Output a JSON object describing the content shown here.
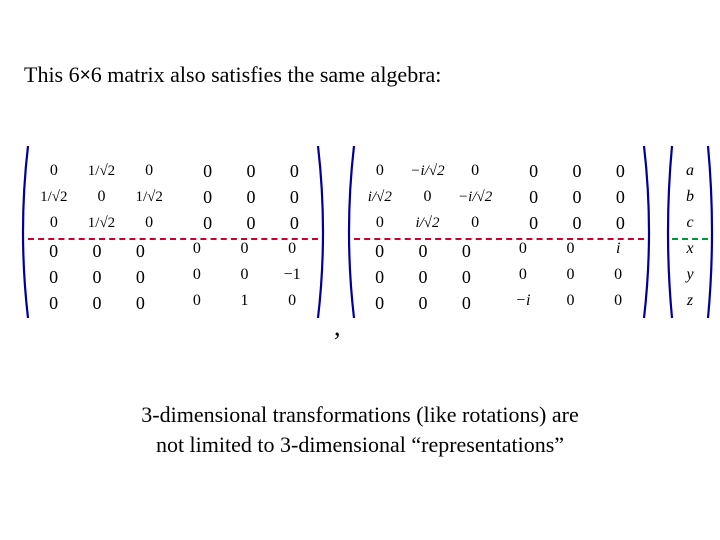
{
  "title": {
    "pre": "This 6",
    "post": "6 matrix also satisfies the same algebra:",
    "times": "×"
  },
  "zeros": [
    "0",
    "0",
    "0",
    "0",
    "0",
    "0",
    "0",
    "0",
    "0"
  ],
  "mat1": {
    "r0": [
      "0",
      "1/√2",
      "0"
    ],
    "r1": [
      "1/√2",
      "0",
      "1/√2"
    ],
    "r2": [
      "0",
      "1/√2",
      "0"
    ],
    "r3": [
      "0",
      "0",
      "0"
    ],
    "r4": [
      "0",
      "0",
      "−1"
    ],
    "r5": [
      "0",
      "1",
      "0"
    ]
  },
  "mat2": {
    "r0": [
      "0",
      "−i/√2",
      "0"
    ],
    "r1": [
      "i/√2",
      "0",
      "−i/√2"
    ],
    "r2": [
      "0",
      "i/√2",
      "0"
    ],
    "r3": [
      "0",
      "0",
      "i"
    ],
    "r4": [
      "0",
      "0",
      "0"
    ],
    "r5": [
      "−i",
      "0",
      "0"
    ]
  },
  "vec": [
    "a",
    "b",
    "c",
    "x",
    "y",
    "z"
  ],
  "comma": ",",
  "footer1": "3-dimensional transformations (like rotations) are",
  "footer2": "not limited to 3-dimensional “representations”",
  "chart_data": {
    "type": "table",
    "title": "This 6×6 matrix also satisfies the same algebra:",
    "matrix1": [
      [
        "0",
        "1/√2",
        "0",
        "0",
        "0",
        "0"
      ],
      [
        "1/√2",
        "0",
        "1/√2",
        "0",
        "0",
        "0"
      ],
      [
        "0",
        "1/√2",
        "0",
        "0",
        "0",
        "0"
      ],
      [
        "0",
        "0",
        "0",
        "0",
        "0",
        "0"
      ],
      [
        "0",
        "0",
        "0",
        "0",
        "0",
        "−1"
      ],
      [
        "0",
        "0",
        "0",
        "0",
        "1",
        "0"
      ]
    ],
    "matrix2": [
      [
        "0",
        "−i/√2",
        "0",
        "0",
        "0",
        "0"
      ],
      [
        "i/√2",
        "0",
        "−i/√2",
        "0",
        "0",
        "0"
      ],
      [
        "0",
        "i/√2",
        "0",
        "0",
        "0",
        "0"
      ],
      [
        "0",
        "0",
        "0",
        "0",
        "0",
        "i"
      ],
      [
        "0",
        "0",
        "0",
        "0",
        "0",
        "0"
      ],
      [
        "0",
        "0",
        "0",
        "−i",
        "0",
        "0"
      ]
    ],
    "vector": [
      "a",
      "b",
      "c",
      "x",
      "y",
      "z"
    ],
    "footer": "3-dimensional transformations (like rotations) are not limited to 3-dimensional “representations”"
  }
}
